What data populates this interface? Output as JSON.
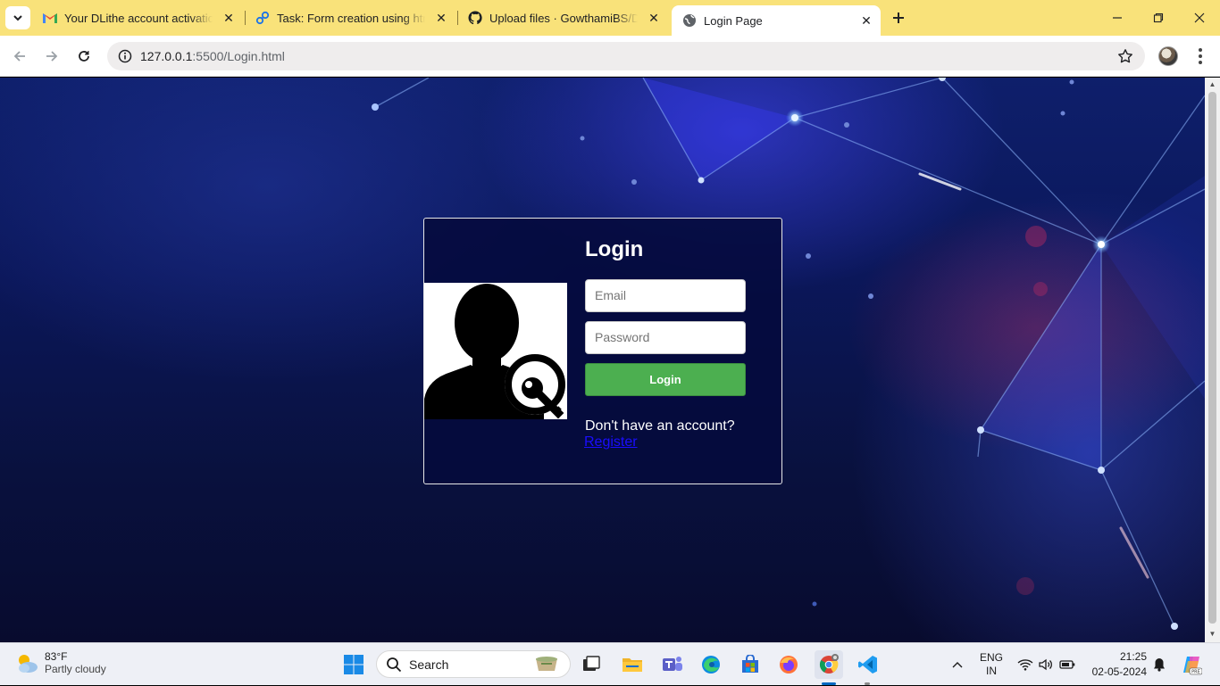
{
  "browser": {
    "tabs": [
      {
        "title": "Your DLithe account activation",
        "icon": "gmail-icon"
      },
      {
        "title": "Task: Form creation using html",
        "icon": "link-icon"
      },
      {
        "title": "Upload files · GowthamiBS/Dlith",
        "icon": "github-icon"
      },
      {
        "title": "Login Page",
        "icon": "globe-icon",
        "active": true
      }
    ],
    "url_host": "127.0.0.1",
    "url_rest": ":5500/Login.html"
  },
  "login": {
    "title": "Login",
    "email_placeholder": "Email",
    "password_placeholder": "Password",
    "button_label": "Login",
    "no_account_text": "Don't have an account?",
    "register_link": "Register"
  },
  "taskbar": {
    "weather_temp": "83°F",
    "weather_desc": "Partly cloudy",
    "search_label": "Search",
    "lang_line1": "ENG",
    "lang_line2": "IN",
    "time": "21:25",
    "date": "02-05-2024"
  },
  "colors": {
    "tabbar": "#f9e27a",
    "login_button": "#4caf50",
    "register_link": "#1a0dff"
  }
}
